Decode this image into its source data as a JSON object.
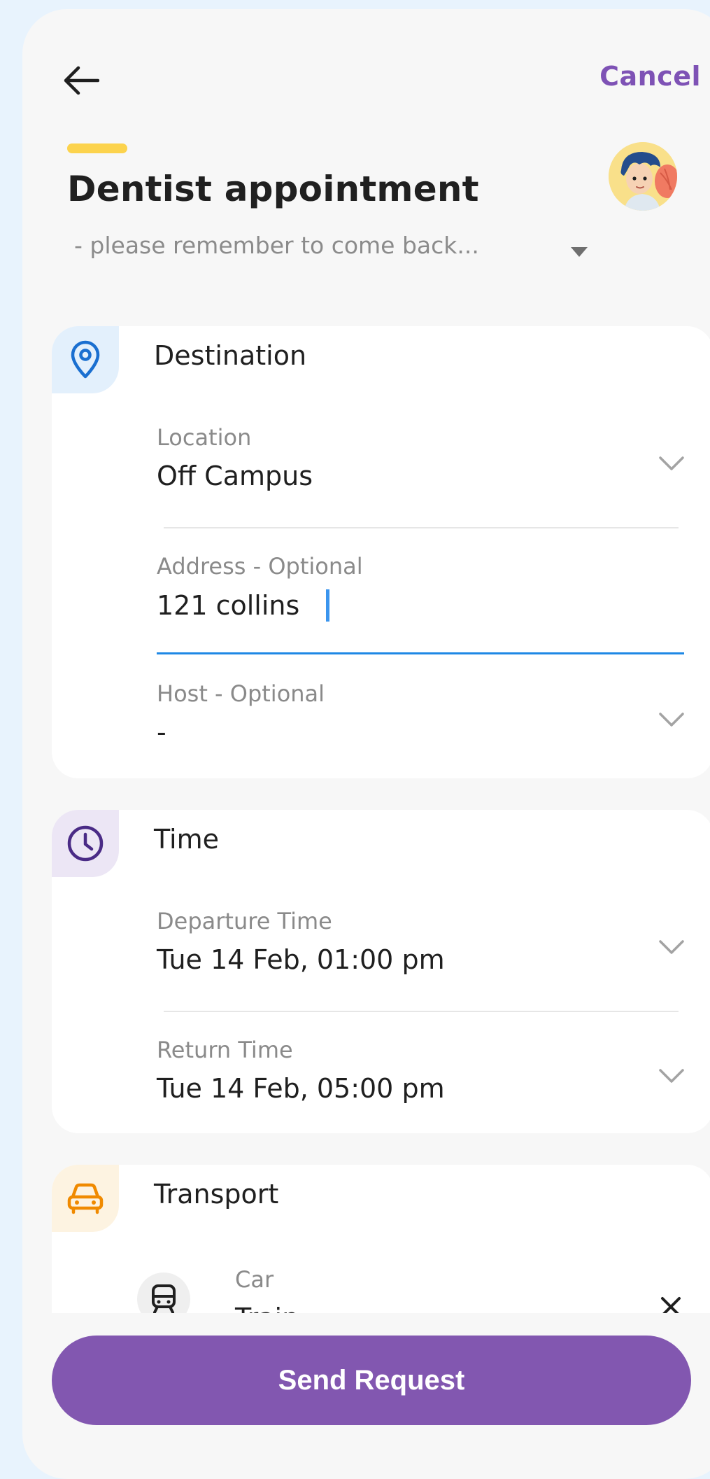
{
  "header": {
    "cancel_label": "Cancel",
    "title": "Dentist appointment",
    "note_preview": "- please remember to come back..."
  },
  "destination": {
    "title": "Destination",
    "location": {
      "label": "Location",
      "value": "Off Campus"
    },
    "address": {
      "label": "Address - Optional",
      "value": "121 collins"
    },
    "host": {
      "label": "Host - Optional",
      "value": "-"
    }
  },
  "time": {
    "title": "Time",
    "departure": {
      "label": "Departure Time",
      "value": "Tue 14 Feb, 01:00 pm"
    },
    "return": {
      "label": "Return Time",
      "value": "Tue 14 Feb, 05:00 pm"
    }
  },
  "transport": {
    "title": "Transport",
    "option_label": "Car",
    "option_value": "Train"
  },
  "actions": {
    "send_label": "Send Request"
  },
  "colors": {
    "accent": "#8257b0",
    "title_underline": "#fcd34d",
    "destination_icon": "#1a6fd0",
    "time_icon": "#4a2b86",
    "transport_icon": "#f08a00",
    "input_focus": "#1e88e5"
  },
  "icons": {
    "back": "arrow-left-icon",
    "destination": "map-pin-icon",
    "time": "clock-icon",
    "transport": "car-icon",
    "train": "train-icon",
    "remove": "close-icon",
    "expand": "chevron-down-icon",
    "note_expand": "caret-down-icon"
  }
}
